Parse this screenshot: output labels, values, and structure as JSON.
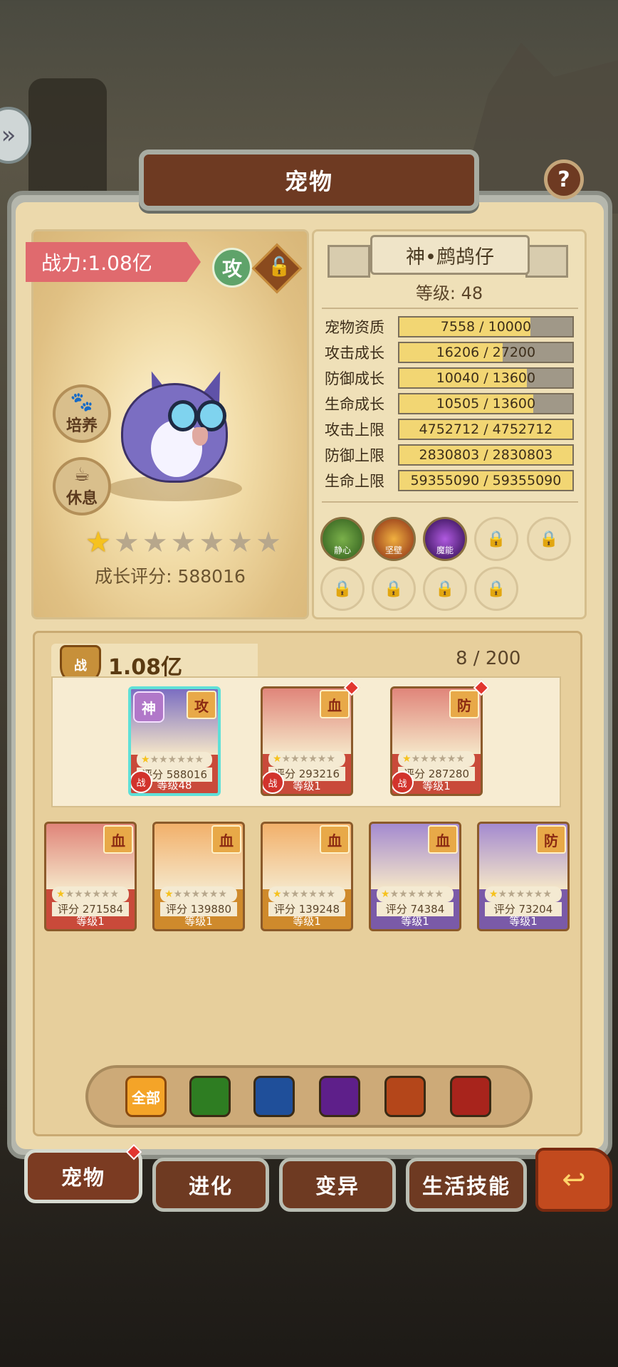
{
  "title": "宠物",
  "help_icon": "question-icon",
  "side_icon": "double-chevron-icon",
  "pet": {
    "power": "战力:1.08亿",
    "type_badge": "攻",
    "lock_icon": "unlock-icon",
    "train_label": "培养",
    "rest_label": "休息",
    "stars_filled": 1,
    "stars_total": 7,
    "growth_score": "成长评分: 588016",
    "name": "神•鹧鸪仔",
    "level": "等级: 48"
  },
  "stats": [
    {
      "label": "宠物资质",
      "value": "7558 / 10000",
      "fraction": 0.7558
    },
    {
      "label": "攻击成长",
      "value": "16206 / 27200",
      "fraction": 0.596
    },
    {
      "label": "防御成长",
      "value": "10040 / 13600",
      "fraction": 0.738
    },
    {
      "label": "生命成长",
      "value": "10505 / 13600",
      "fraction": 0.772
    },
    {
      "label": "攻击上限",
      "value": "4752712 / 4752712",
      "fraction": 1.0
    },
    {
      "label": "防御上限",
      "value": "2830803 / 2830803",
      "fraction": 1.0
    },
    {
      "label": "生命上限",
      "value": "59355090 / 59355090",
      "fraction": 1.0
    }
  ],
  "skills": [
    {
      "name": "静心",
      "color": "#3f7a2a"
    },
    {
      "name": "坚壁",
      "color": "#a8381c"
    },
    {
      "name": "魔能",
      "color": "#5a2a7a"
    }
  ],
  "locked_skill_slots": 6,
  "team": {
    "power": "1.08亿",
    "power_icon_label": "战",
    "count": "8 / 200"
  },
  "cards_team": [
    {
      "rank": "神",
      "element": "攻",
      "score": "评分 588016",
      "level": "等级48",
      "art": "#7b6ec2",
      "frame": "#c94a3a",
      "selected": true,
      "zhan": "战"
    },
    {
      "element": "血",
      "score": "评分 293216",
      "level": "等级1",
      "art": "#e0857a",
      "frame": "#c94a3a",
      "zhan": "战",
      "red_dot": true
    },
    {
      "element": "防",
      "score": "评分 287280",
      "level": "等级1",
      "art": "#e0857a",
      "frame": "#c94a3a",
      "zhan": "战",
      "red_dot": true
    }
  ],
  "cards_bench": [
    {
      "element": "血",
      "score": "评分 271584",
      "level": "等级1",
      "art": "#e0857a",
      "frame": "#c94a3a"
    },
    {
      "element": "血",
      "score": "评分 139880",
      "level": "等级1",
      "art": "#f2b06a",
      "frame": "#cf8a2c"
    },
    {
      "element": "血",
      "score": "评分 139248",
      "level": "等级1",
      "art": "#f2b06a",
      "frame": "#cf8a2c"
    },
    {
      "element": "血",
      "score": "评分 74384",
      "level": "等级1",
      "art": "#a48ad0",
      "frame": "#7a5aa8"
    },
    {
      "element": "防",
      "score": "评分 73204",
      "level": "等级1",
      "art": "#a48ad0",
      "frame": "#7a5aa8"
    }
  ],
  "filters": {
    "all_label": "全部",
    "gems": [
      "#2e7d22",
      "#1f4f9a",
      "#5e1f8a",
      "#b4461a",
      "#a8241c"
    ]
  },
  "tabs": [
    {
      "label": "宠物",
      "active": true,
      "red_dot": true
    },
    {
      "label": "进化"
    },
    {
      "label": "变异"
    },
    {
      "label": "生活技能"
    }
  ],
  "back_icon": "return-arrow-icon"
}
